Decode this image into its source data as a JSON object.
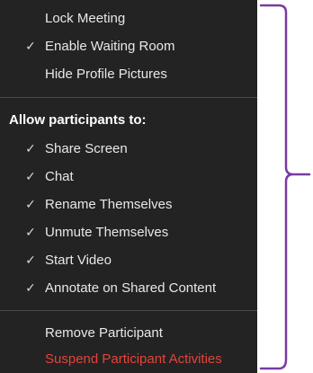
{
  "menu": {
    "top_items": [
      {
        "label": "Lock Meeting",
        "checked": false
      },
      {
        "label": "Enable Waiting Room",
        "checked": true
      },
      {
        "label": "Hide Profile Pictures",
        "checked": false
      }
    ],
    "section_header": "Allow participants to:",
    "permission_items": [
      {
        "label": "Share Screen",
        "checked": true
      },
      {
        "label": "Chat",
        "checked": true
      },
      {
        "label": "Rename Themselves",
        "checked": true
      },
      {
        "label": "Unmute Themselves",
        "checked": true
      },
      {
        "label": "Start Video",
        "checked": true
      },
      {
        "label": "Annotate on Shared Content",
        "checked": true
      }
    ],
    "bottom_items": [
      {
        "label": "Remove Participant"
      },
      {
        "label": "Suspend Participant Activities"
      }
    ],
    "check_glyph": "✓"
  },
  "colors": {
    "menu_background": "#232323",
    "text": "#e8e8e8",
    "danger": "#e5433a",
    "annotation_brace": "#7b3aa0"
  }
}
